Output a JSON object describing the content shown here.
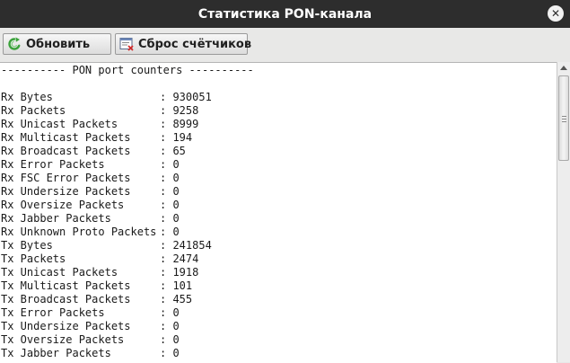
{
  "window": {
    "title": "Статистика PON-канала",
    "close_glyph": "✕"
  },
  "toolbar": {
    "refresh_label": "Обновить",
    "reset_label": "Сброс счётчиков"
  },
  "report": {
    "header": "---------- PON port counters ----------",
    "separator": ": ",
    "rows": [
      {
        "label": "Rx Bytes",
        "value": "930051"
      },
      {
        "label": "Rx Packets",
        "value": "9258"
      },
      {
        "label": "Rx Unicast Packets",
        "value": "8999"
      },
      {
        "label": "Rx Multicast Packets",
        "value": "194"
      },
      {
        "label": "Rx Broadcast Packets",
        "value": "65"
      },
      {
        "label": "Rx Error Packets",
        "value": "0"
      },
      {
        "label": "Rx FSC Error Packets",
        "value": "0"
      },
      {
        "label": "Rx Undersize Packets",
        "value": "0"
      },
      {
        "label": "Rx Oversize Packets",
        "value": "0"
      },
      {
        "label": "Rx Jabber Packets",
        "value": "0"
      },
      {
        "label": "Rx Unknown Proto Packets",
        "value": "0"
      },
      {
        "label": "Tx Bytes",
        "value": "241854"
      },
      {
        "label": "Tx Packets",
        "value": "2474"
      },
      {
        "label": "Tx Unicast Packets",
        "value": "1918"
      },
      {
        "label": "Tx Multicast Packets",
        "value": "101"
      },
      {
        "label": "Tx Broadcast Packets",
        "value": "455"
      },
      {
        "label": "Tx Error Packets",
        "value": "0"
      },
      {
        "label": "Tx Undersize Packets",
        "value": "0"
      },
      {
        "label": "Tx Oversize Packets",
        "value": "0"
      },
      {
        "label": "Tx Jabber Packets",
        "value": "0"
      }
    ]
  },
  "icons": {
    "refresh": "refresh-icon",
    "reset": "reset-counters-icon",
    "close": "close-icon"
  }
}
